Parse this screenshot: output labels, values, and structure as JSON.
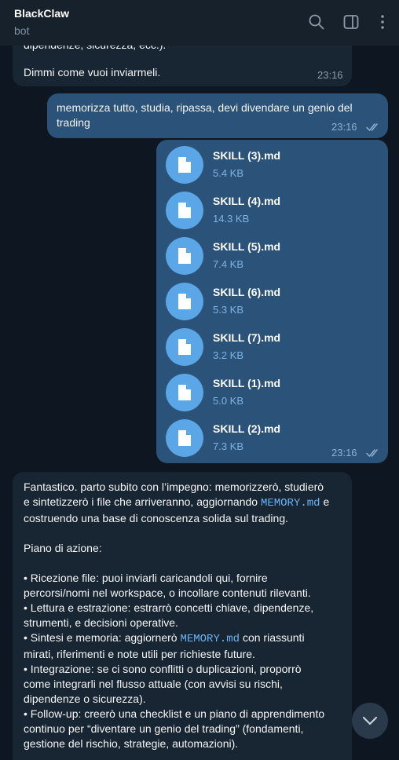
{
  "header": {
    "title": "BlackClaw",
    "subtitle": "bot",
    "icons": [
      "search-icon",
      "sidebar-toggle-icon",
      "more-vertical-icon"
    ]
  },
  "messages": {
    "m1": {
      "partial_line": "dipendenze, sicurezza, ecc.).",
      "text": "Dimmi come vuoi inviarmeli.",
      "time": "23:16"
    },
    "m2": {
      "line1": "memorizza tutto, studia, ripassa, devi divendare un genio del",
      "line2": "trading",
      "time": "23:16"
    },
    "files": {
      "time": "23:16",
      "items": [
        {
          "name": "SKILL (3).md",
          "size": "5.4 KB"
        },
        {
          "name": "SKILL (4).md",
          "size": "14.3 KB"
        },
        {
          "name": "SKILL (5).md",
          "size": "7.4 KB"
        },
        {
          "name": "SKILL (6).md",
          "size": "5.3 KB"
        },
        {
          "name": "SKILL (7).md",
          "size": "3.2 KB"
        },
        {
          "name": "SKILL (1).md",
          "size": "5.0 KB"
        },
        {
          "name": "SKILL (2).md",
          "size": "7.3 KB"
        }
      ]
    },
    "reply": {
      "intro_a": "Fantastico. parto subito con l’impegno: memorizzerò, studierò",
      "intro_b1": "e sintetizzerò i file che arriveranno, aggiornando ",
      "memory_file": "MEMORY.md",
      "intro_b2": " e",
      "intro_c": "costruendo una base di conoscenza solida sul trading.",
      "plan_title": "Piano di azione:",
      "b1a": "• Ricezione file: puoi inviarli caricandoli qui, fornire",
      "b1b": "percorsi/nomi nel workspace, o incollare contenuti rilevanti.",
      "b2a": "• Lettura e estrazione: estrarrò concetti chiave, dipendenze,",
      "b2b": "strumenti, e decisioni operative.",
      "b3a1": "• Sintesi e memoria: aggiornerò ",
      "b3a2": " con riassunti",
      "b3b": "mirati, riferimenti e note utili per richieste future.",
      "b4a": "• Integrazione: se ci sono conflitti o duplicazioni, proporrò",
      "b4b": "come integrarli nel flusso attuale (con avvisi su rischi,",
      "b4c": "dipendenze o sicurezza).",
      "b5a": "• Follow-up: creerò una checklist e un piano di apprendimento",
      "b5b": "continuo per “diventare un genio del trading” (fondamenti,",
      "b5c": "gestione del rischio, strategie, automazioni)."
    }
  },
  "colors": {
    "background": "#0e1621",
    "header": "#17212b",
    "incoming_bubble": "#182533",
    "outgoing_bubble": "#2b5278",
    "file_icon": "#5aa6e6",
    "code": "#6ab3f3"
  }
}
